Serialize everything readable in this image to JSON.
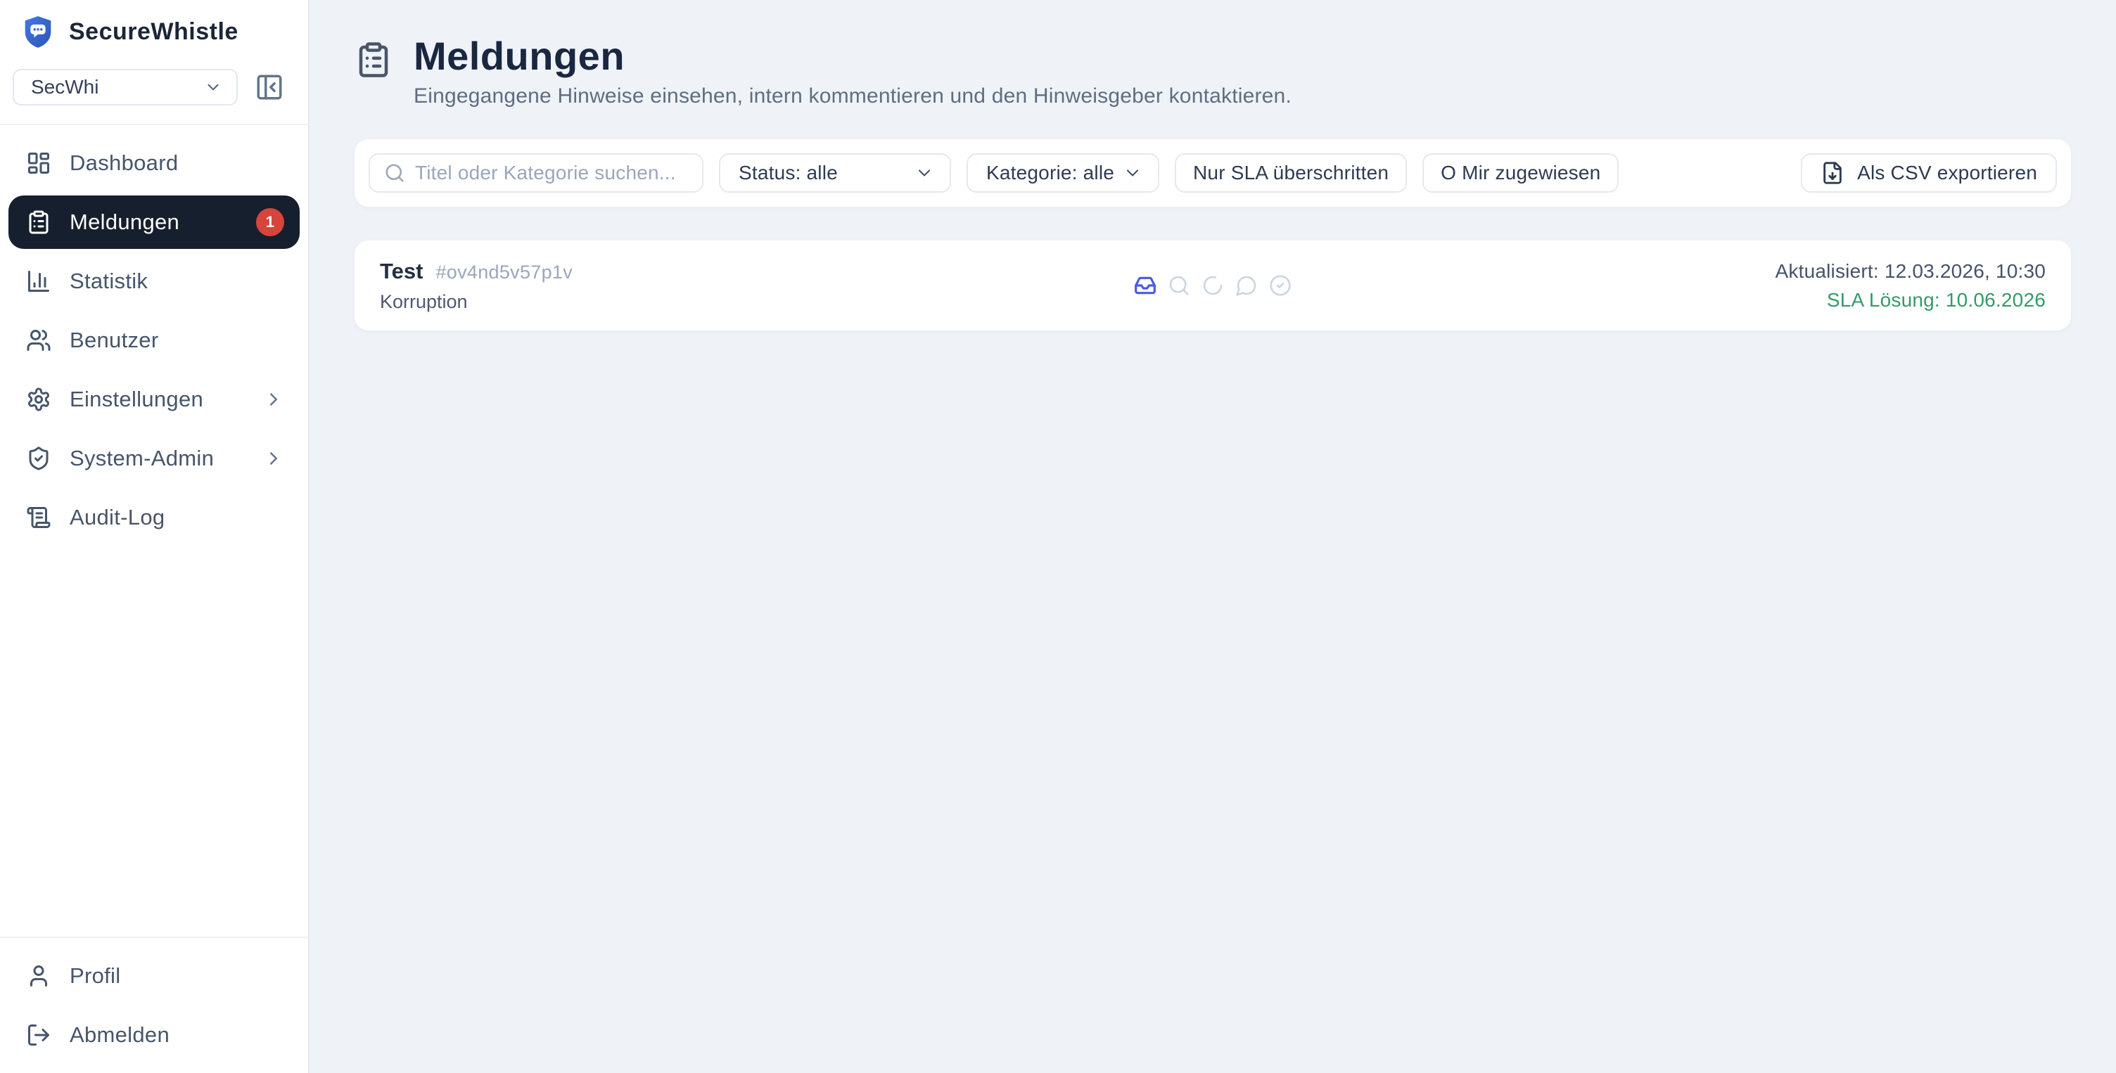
{
  "brand": {
    "name": "SecureWhistle",
    "org_select_value": "SecWhi"
  },
  "sidebar": {
    "items": [
      {
        "label": "Dashboard"
      },
      {
        "label": "Meldungen",
        "badge": "1",
        "active": true
      },
      {
        "label": "Statistik"
      },
      {
        "label": "Benutzer"
      },
      {
        "label": "Einstellungen",
        "expandable": true
      },
      {
        "label": "System-Admin",
        "expandable": true
      },
      {
        "label": "Audit-Log"
      }
    ],
    "footer_items": [
      {
        "label": "Profil"
      },
      {
        "label": "Abmelden"
      }
    ]
  },
  "header": {
    "title": "Meldungen",
    "subtitle": "Eingegangene Hinweise einsehen, intern kommentieren und den Hinweisgeber kontaktieren."
  },
  "filters": {
    "search_placeholder": "Titel oder Kategorie suchen...",
    "search_value": "",
    "status_label": "Status: alle",
    "category_label": "Kategorie: alle",
    "sla_button": "Nur SLA überschritten",
    "assigned_button": "O Mir zugewiesen",
    "export_button": "Als CSV exportieren"
  },
  "reports": [
    {
      "title": "Test",
      "id": "#ov4nd5v57p1v",
      "category": "Korruption",
      "updated": "Aktualisiert: 12.03.2026, 10:30",
      "sla": "SLA Lösung: 10.06.2026",
      "status_icons": [
        "inbox",
        "review",
        "in-progress",
        "communication",
        "resolved"
      ],
      "active_status": "inbox"
    }
  ],
  "colors": {
    "accent_blue": "#4a5be0",
    "badge_red": "#d6453c",
    "active_nav": "#161f2d",
    "sla_green": "#36996a",
    "brand_blue": "#3565cf",
    "page_bg": "#eff3f8"
  }
}
